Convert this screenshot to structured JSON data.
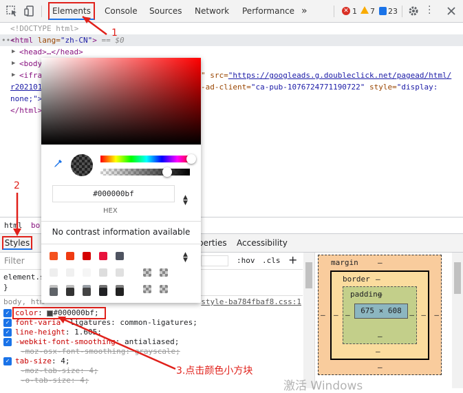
{
  "toolbar": {
    "tabs": [
      "Elements",
      "Console",
      "Sources",
      "Network",
      "Performance"
    ],
    "more": "»",
    "errors": "1",
    "warnings": "7",
    "issues": "23"
  },
  "tree": {
    "doctype": "<!DOCTYPE html>",
    "html_open_tag": "<html",
    "html_lang_attr": " lang=",
    "html_lang_val": "\"zh-CN\"",
    "html_close_bracket": ">",
    "html_eq": "== $0",
    "head": "<head>…</head>",
    "body": "<body",
    "iframe": "<ifra",
    "iframe_src_attr": "\" src=",
    "iframe_src_val": "\"https://googleads.g.doubleclick.net/pagead/html/",
    "line4a": "r202101",
    "line4b": "-ad-client=",
    "line4c": "\"ca-pub-1076724771190722\"",
    "line4d": " style=",
    "line4e": "\"display:",
    "line5": "none;\">",
    "html_close": "</html>"
  },
  "crumb": {
    "a": "html",
    "b": "bo"
  },
  "subtabs": {
    "styles": "Styles",
    "properties": "perties",
    "accessibility": "Accessibility"
  },
  "filter": {
    "placeholder": "Filter",
    "hov": ":hov",
    "cls": ".cls",
    "plus": "+"
  },
  "styles": {
    "element_selector": "element.s",
    "brace_close": "}",
    "body_selector": "body, htm",
    "source": "style-ba784fbaf8.css:1",
    "rules": [
      {
        "prop": "color",
        "value": "#000000bf;"
      },
      {
        "prop": "font-varia",
        "value": "ligatures: common-ligatures;"
      },
      {
        "prop": "line-height",
        "value": "1.605;"
      },
      {
        "prop": "-webkit-font-smoothing",
        "value": "antialiased;"
      },
      {
        "prop": "-moz-osx-font-smoothing",
        "value": "grayscale;"
      },
      {
        "prop": "tab-size",
        "value": "4;"
      },
      {
        "prop": "-moz-tab-size",
        "value": "4;"
      },
      {
        "prop": "-o-tab-size",
        "value": "4;"
      }
    ]
  },
  "box_model": {
    "margin": "margin",
    "border": "border",
    "padding": "padding",
    "content": "675 × 608",
    "dash": "–"
  },
  "picker": {
    "hex_value": "#000000bf",
    "hex_label": "HEX",
    "contrast": "No contrast information available",
    "swatches": [
      "#f4511e",
      "#ef3b12",
      "#d50000",
      "#e8123c",
      "#4e5360",
      "#eeeeee",
      "#f0f0f0",
      "#f5f5f5",
      "#dddddd",
      "#e0e0e0",
      "#c2c2c2",
      "#bdbdbd",
      "#9aa0a6",
      "#757575",
      "#808080",
      "#5f6368",
      "#333333",
      "#444444",
      "#202124",
      "#212121"
    ]
  },
  "annotations": {
    "one": "1",
    "two": "2",
    "three": "3.点击颜色小方块"
  },
  "watermark": "激活 Windows",
  "colors": {
    "accent": "#1a73e8",
    "annotation": "#e0201a",
    "error": "#d93025",
    "warning": "#f9ab00"
  }
}
